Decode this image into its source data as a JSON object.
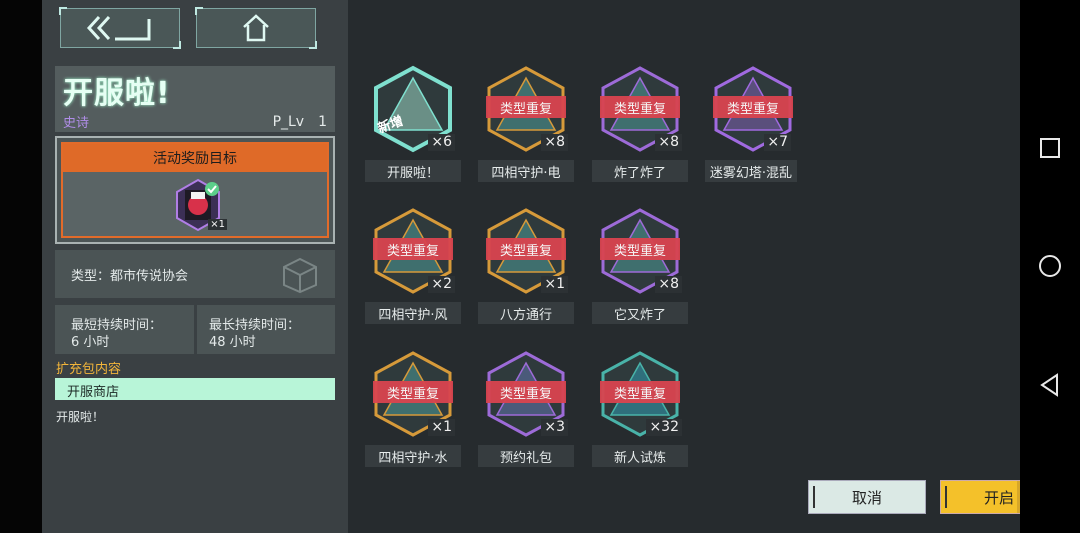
{
  "header": {
    "back_icon": "double-chevron-left-icon",
    "home_icon": "home-icon"
  },
  "pack": {
    "title": "开服啦!",
    "rarity": "史诗",
    "level": "P_Lv　1",
    "reward_header": "活动奖励目标",
    "reward_count": "×1",
    "type_text": "类型：都市传说协会",
    "min_duration_label": "最短持续时间：",
    "min_duration_value": "6 小时",
    "max_duration_label": "最长持续时间：",
    "max_duration_value": "48 小时",
    "contents_header": "扩充包内容",
    "contents_item": "开服商店",
    "description": "开服啦！"
  },
  "cards": [
    {
      "label": "开服啦！",
      "count": "×6",
      "badge": "新增",
      "banner": ""
    },
    {
      "label": "四相守护·电",
      "count": "×8",
      "badge": "",
      "banner": "类型重复"
    },
    {
      "label": "炸了炸了",
      "count": "×8",
      "badge": "",
      "banner": "类型重复"
    },
    {
      "label": "迷雾幻塔·混乱",
      "count": "×7",
      "badge": "",
      "banner": "类型重复"
    },
    {
      "label": "四相守护·风",
      "count": "×2",
      "badge": "",
      "banner": "类型重复"
    },
    {
      "label": "八方通行",
      "count": "×1",
      "badge": "",
      "banner": "类型重复"
    },
    {
      "label": "它又炸了",
      "count": "×8",
      "badge": "",
      "banner": "类型重复"
    },
    {
      "label": "四相守护·水",
      "count": "×1",
      "badge": "",
      "banner": "类型重复"
    },
    {
      "label": "预约礼包",
      "count": "×3",
      "badge": "",
      "banner": "类型重复"
    },
    {
      "label": "新人试炼",
      "count": "×32",
      "badge": "",
      "banner": "类型重复"
    }
  ],
  "actions": {
    "cancel": "取消",
    "open": "开启"
  },
  "android_nav": {
    "recent_icon": "square-icon",
    "home_icon": "circle-icon",
    "back_icon": "triangle-back-icon"
  },
  "colors": {
    "accent_orange": "#df6a28",
    "banner_red": "#d9444f",
    "open_yellow": "#f4c12a",
    "mint": "#b8f5d8"
  }
}
